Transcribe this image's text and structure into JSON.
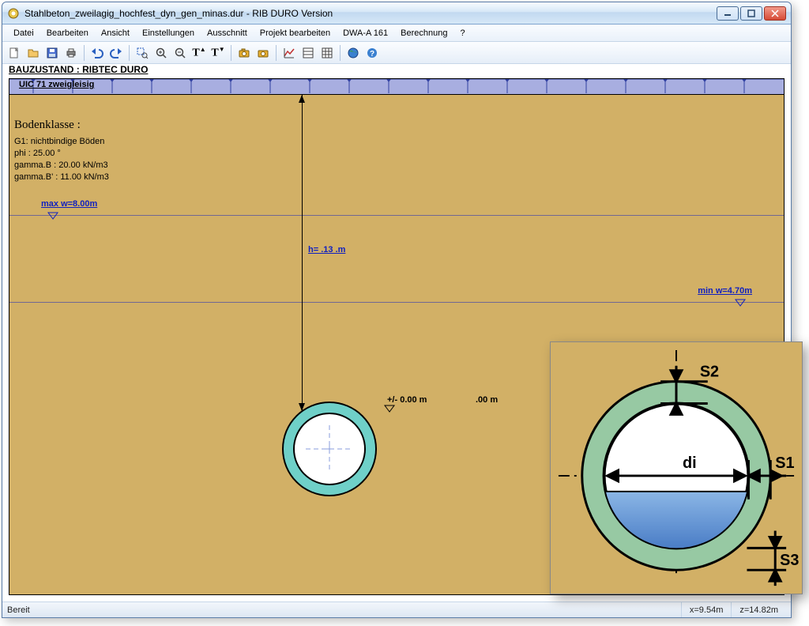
{
  "window": {
    "title": "Stahlbeton_zweilagig_hochfest_dyn_gen_minas.dur - RIB DURO Version"
  },
  "menu": {
    "items": [
      "Datei",
      "Bearbeiten",
      "Ansicht",
      "Einstellungen",
      "Ausschnitt",
      "Projekt bearbeiten",
      "DWA-A 161",
      "Berechnung",
      "?"
    ]
  },
  "toolbar": {
    "icons": [
      "new-icon",
      "open-icon",
      "save-icon",
      "print-icon",
      "sep",
      "undo-icon",
      "redo-icon",
      "sep",
      "zoom-window-icon",
      "zoom-in-icon",
      "zoom-out-icon",
      "text-big-icon",
      "text-small-icon",
      "sep",
      "camera-icon",
      "camera2-icon",
      "sep",
      "chart-icon",
      "form-icon",
      "table-icon",
      "sep",
      "globe-icon",
      "help-icon"
    ]
  },
  "heading": "BAUZUSTAND : RIBTEC DURO",
  "load": {
    "label": "UIC 71 zweigleisig"
  },
  "soil": {
    "title": "Bodenklasse :",
    "lines": [
      "G1: nichtbindige Böden",
      "phi : 25.00 °",
      "gamma.B : 20.00 kN/m3",
      "gamma.B' : 11.00 kN/m3"
    ]
  },
  "water": {
    "max": "max w=8.00m",
    "min": "min w=4.70m"
  },
  "depth": {
    "label": "h= .13 .m"
  },
  "ground": {
    "left": "+/- 0.00 m",
    "right": ".00 m"
  },
  "detail": {
    "labels": {
      "s1": "S1",
      "s2": "S2",
      "s3": "S3",
      "di": "di"
    }
  },
  "status": {
    "ready": "Bereit",
    "x": "x=9.54m",
    "z": "z=14.82m"
  }
}
